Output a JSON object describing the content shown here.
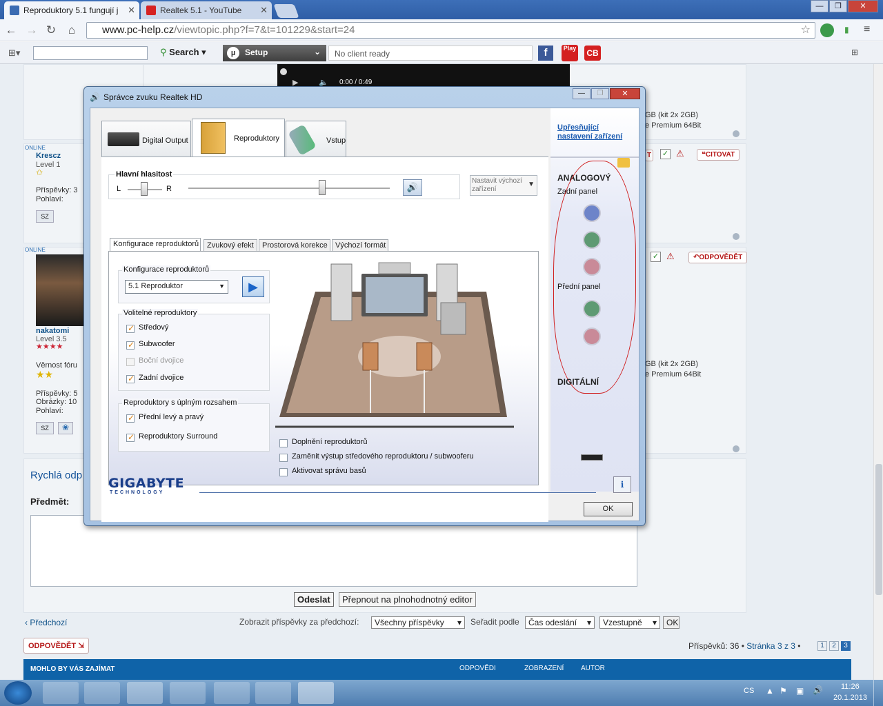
{
  "browser": {
    "tabs": [
      {
        "title": "Reproduktory 5.1 fungují j",
        "active": true
      },
      {
        "title": "Realtek 5.1 - YouTube",
        "active": false
      }
    ],
    "url_host": "www.pc-help.cz",
    "url_path": "/viewtopic.php?f=7&t=101229&start=24",
    "toolbar": {
      "search_label": "Search",
      "setup_label": "Setup",
      "client_status": "No client ready",
      "play_label": "Play",
      "cb_label": "CB"
    },
    "video_time": "0:00 / 0:49"
  },
  "forum": {
    "posts": [
      {
        "status": "ONLINE",
        "username": "Krescz",
        "level": "Level 1",
        "posts_label": "Příspěvky: 3",
        "gender_label": "Pohlaví:",
        "spec_right": "GB (kit 2x 2GB)",
        "os_right": "e Premium 64Bit",
        "action": "CITOVAT"
      },
      {
        "status": "ONLINE",
        "username": "nakatomi",
        "level": "Level 3.5",
        "loyalty": "Věrnost fóru",
        "posts_label": "Příspěvky: 5",
        "images_label": "Obrázky: 10",
        "gender_label": "Pohlaví:",
        "spec_right": "GB (kit 2x 2GB)",
        "os_right": "e Premium 64Bit",
        "action": "ODPOVĚDĚT"
      }
    ],
    "badge_sz": "SZ",
    "quick_reply_title": "Rychlá odp",
    "subject_label": "Předmět:",
    "send_button": "Odeslat",
    "full_editor_button": "Přepnout na plnohodnotný editor",
    "prev_link": "Předchozí",
    "show_posts_label": "Zobrazit příspěvky za předchozí:",
    "show_posts_value": "Všechny příspěvky",
    "sort_label": "Seřadit podle",
    "sort_value": "Čas odeslání",
    "order_value": "Vzestupně",
    "ok": "OK",
    "reply_button": "ODPOVĚDĚT",
    "posts_count": "Příspěvků: 36",
    "page_info": "Stránka 3 z 3",
    "pages": [
      "1",
      "2",
      "3"
    ],
    "related_title": "MOHLO BY VÁS ZAJÍMAT",
    "col_replies": "ODPOVĚDI",
    "col_views": "ZOBRAZENÍ",
    "col_author": "AUTOR"
  },
  "dialog": {
    "title": "Správce zvuku Realtek HD",
    "tabs": [
      "Digital Output",
      "Reproduktory",
      "Vstup"
    ],
    "volume_label": "Hlavní hlasitost",
    "left": "L",
    "right": "R",
    "default_device": "Nastavit výchozí zařízení",
    "subtabs": [
      "Konfigurace reproduktorů",
      "Zvukový efekt",
      "Prostorová korekce",
      "Výchozí formát"
    ],
    "config_group": "Konfigurace reproduktorů",
    "config_value": "5.1 Reproduktor",
    "optional_group": "Volitelné reproduktory",
    "optional": [
      {
        "label": "Středový",
        "checked": true,
        "enabled": true
      },
      {
        "label": "Subwoofer",
        "checked": true,
        "enabled": true
      },
      {
        "label": "Boční dvojice",
        "checked": false,
        "enabled": false
      },
      {
        "label": "Zadní dvojice",
        "checked": true,
        "enabled": true
      }
    ],
    "fullrange_group": "Reproduktory s úplným rozsahem",
    "fullrange": [
      {
        "label": "Přední levý a pravý",
        "checked": true
      },
      {
        "label": "Reproduktory Surround",
        "checked": true
      }
    ],
    "bottom_options": [
      {
        "label": "Doplnění reproduktorů",
        "checked": false
      },
      {
        "label": "Zaměnit výstup středového reproduktoru / subwooferu",
        "checked": false
      },
      {
        "label": "Aktivovat správu basů",
        "checked": false
      }
    ],
    "advanced_link": "Upřesňující nastavení zařízení",
    "analog_label": "ANALOGOVÝ",
    "rear_panel": "Zadní panel",
    "front_panel": "Přední panel",
    "digital_label": "DIGITÁLNÍ",
    "brand": "GIGABYTE",
    "brand_sub": "TECHNOLOGY",
    "ok_button": "OK",
    "jack_colors": {
      "blue": "#6d84c9",
      "green": "#5e9a73",
      "pink": "#c98a98"
    }
  },
  "taskbar": {
    "lang": "CS",
    "time": "11:26",
    "date": "20.1.2013"
  }
}
